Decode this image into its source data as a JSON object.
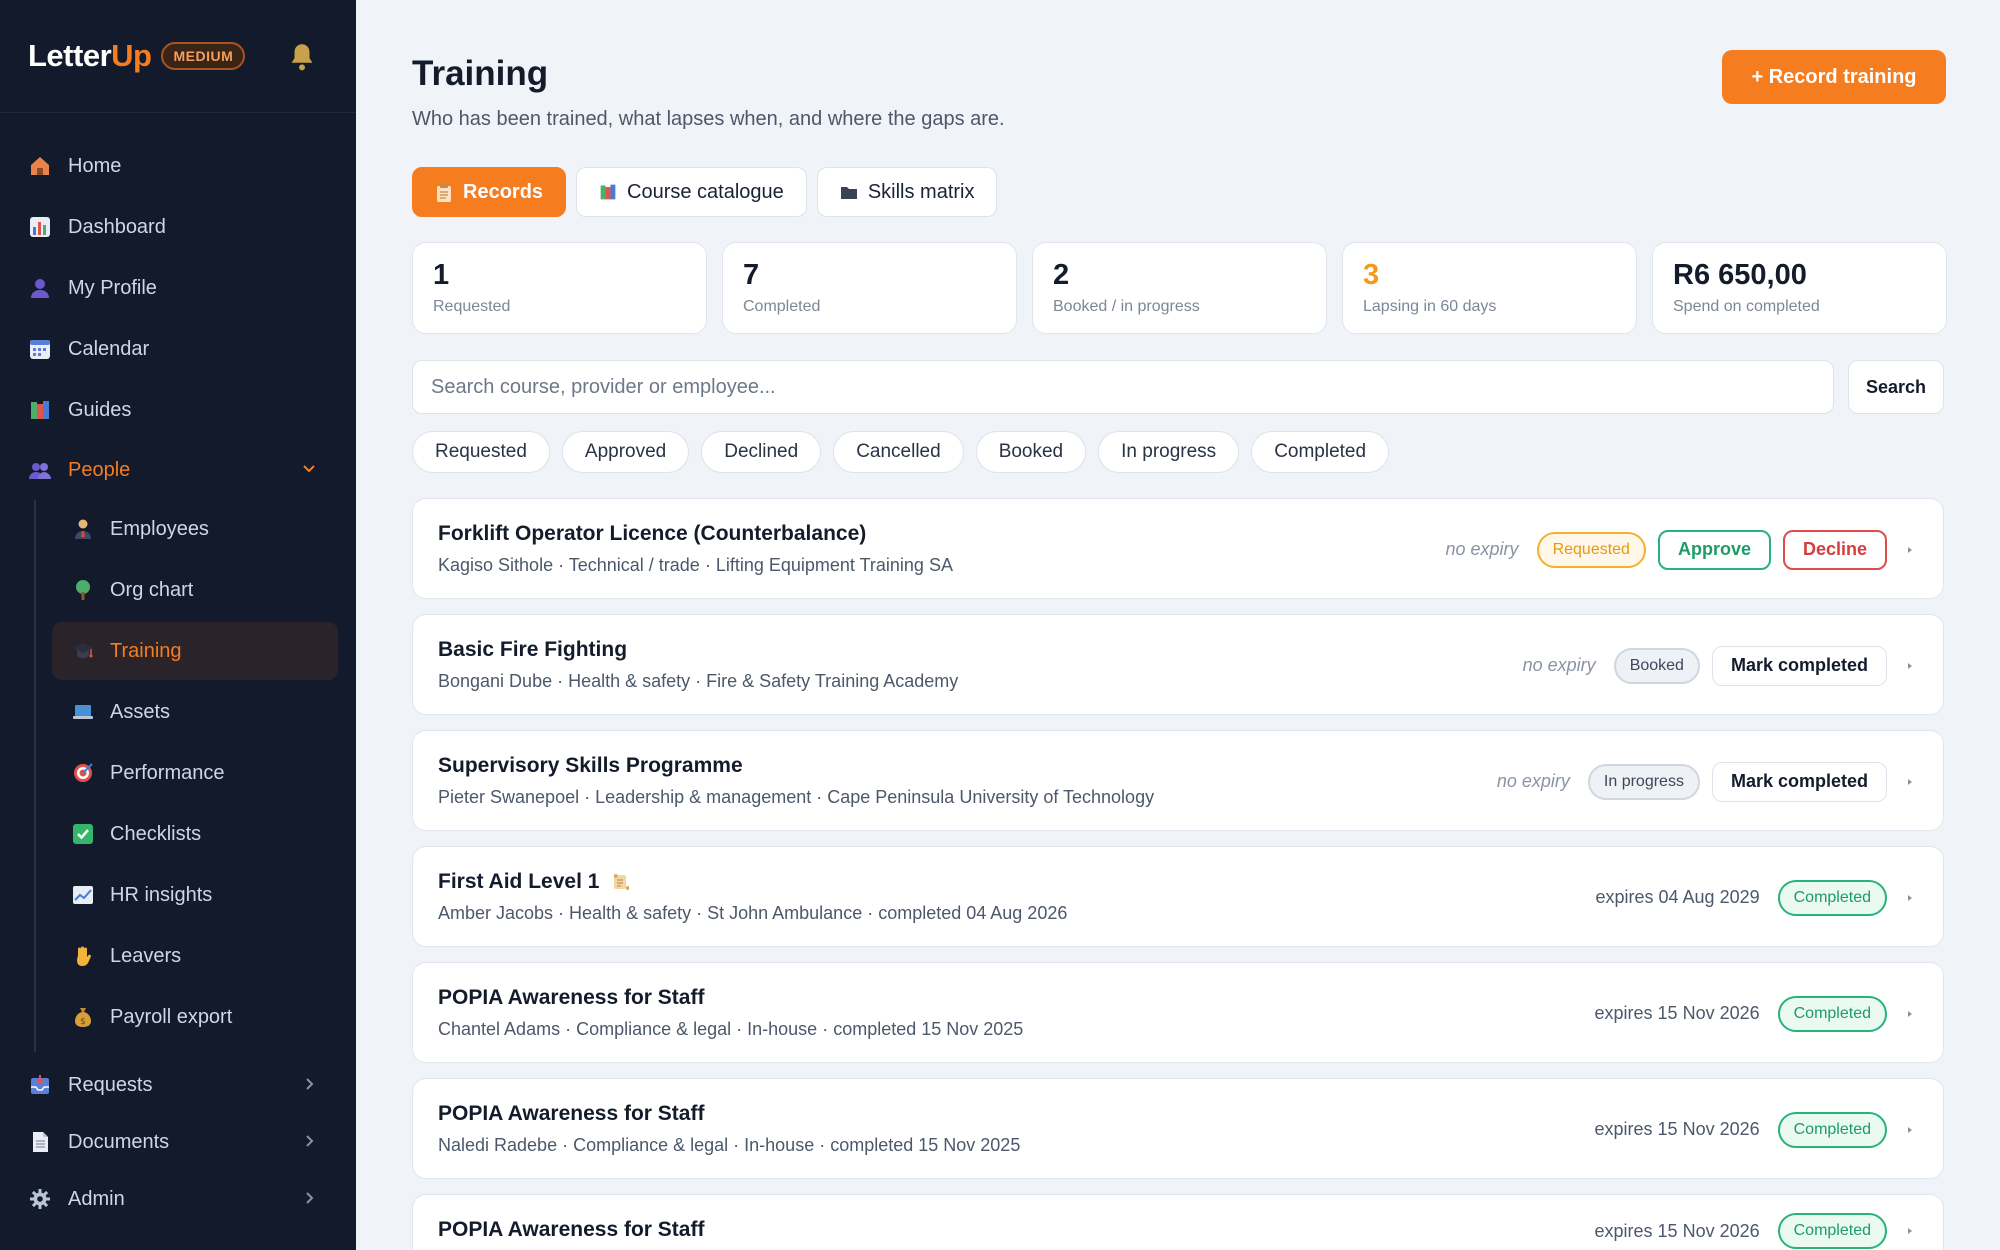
{
  "brand": {
    "name_a": "Letter",
    "name_b": "Up",
    "tier": "MEDIUM"
  },
  "nav": {
    "home": "Home",
    "dashboard": "Dashboard",
    "profile": "My Profile",
    "calendar": "Calendar",
    "guides": "Guides",
    "people": "People",
    "people_sub": {
      "employees": "Employees",
      "org_chart": "Org chart",
      "training": "Training",
      "assets": "Assets",
      "performance": "Performance",
      "checklists": "Checklists",
      "hr_insights": "HR insights",
      "leavers": "Leavers",
      "payroll_export": "Payroll export"
    },
    "requests": "Requests",
    "documents": "Documents",
    "admin": "Admin"
  },
  "page": {
    "title": "Training",
    "subtitle": "Who has been trained, what lapses when, and where the gaps are.",
    "record_button": "+ Record training"
  },
  "tabs": {
    "records": "Records",
    "catalogue": "Course catalogue",
    "matrix": "Skills matrix"
  },
  "stats": [
    {
      "value": "1",
      "label": "Requested"
    },
    {
      "value": "7",
      "label": "Completed"
    },
    {
      "value": "2",
      "label": "Booked / in progress"
    },
    {
      "value": "3",
      "label": "Lapsing in 60 days"
    },
    {
      "value": "R6 650,00",
      "label": "Spend on completed"
    }
  ],
  "search": {
    "placeholder": "Search course, provider or employee...",
    "button": "Search"
  },
  "filters": [
    "Requested",
    "Approved",
    "Declined",
    "Cancelled",
    "Booked",
    "In progress",
    "Completed"
  ],
  "records": [
    {
      "title": "Forklift Operator Licence (Counterbalance)",
      "meta": "Kagiso Sithole · Technical / trade · Lifting Equipment Training SA",
      "expiry": "no expiry",
      "status": "Requested",
      "approve": "Approve",
      "decline": "Decline"
    },
    {
      "title": "Basic Fire Fighting",
      "meta": "Bongani Dube · Health & safety · Fire & Safety Training Academy",
      "expiry": "no expiry",
      "status": "Booked",
      "action": "Mark completed"
    },
    {
      "title": "Supervisory Skills Programme",
      "meta": "Pieter Swanepoel · Leadership & management · Cape Peninsula University of Technology",
      "expiry": "no expiry",
      "status": "In progress",
      "action": "Mark completed"
    },
    {
      "title": "First Aid Level 1",
      "meta": "Amber Jacobs · Health & safety · St John Ambulance · completed 04 Aug 2026",
      "expiry": "expires 04 Aug 2029",
      "status": "Completed"
    },
    {
      "title": "POPIA Awareness for Staff",
      "meta": "Chantel Adams · Compliance & legal · In-house · completed 15 Nov 2025",
      "expiry": "expires 15 Nov 2026",
      "status": "Completed"
    },
    {
      "title": "POPIA Awareness for Staff",
      "meta": "Naledi Radebe · Compliance & legal · In-house · completed 15 Nov 2025",
      "expiry": "expires 15 Nov 2026",
      "status": "Completed"
    },
    {
      "title": "POPIA Awareness for Staff",
      "meta": "",
      "expiry": "expires 15 Nov 2026",
      "status": "Completed"
    }
  ],
  "colors": {
    "accent": "#f57c1f",
    "sidebar": "#121a2b",
    "success": "#27b37a",
    "danger": "#e04b4b",
    "warning": "#f3b12e"
  }
}
